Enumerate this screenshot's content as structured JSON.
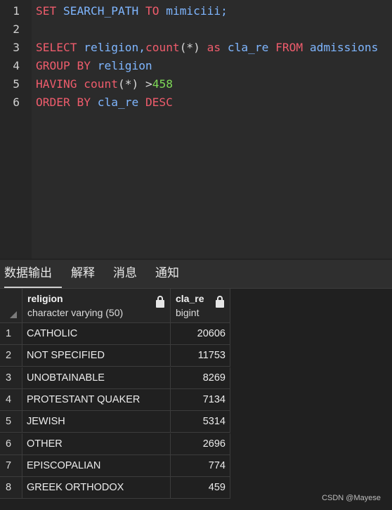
{
  "editor": {
    "lines": [
      {
        "num": "1",
        "tokens": [
          {
            "t": "SET",
            "c": "kw"
          },
          {
            "t": " ",
            "c": "op"
          },
          {
            "t": "SEARCH_PATH",
            "c": "id"
          },
          {
            "t": " ",
            "c": "op"
          },
          {
            "t": "TO",
            "c": "kw"
          },
          {
            "t": " mimiciii;",
            "c": "id"
          }
        ]
      },
      {
        "num": "2",
        "tokens": []
      },
      {
        "num": "3",
        "tokens": [
          {
            "t": "SELECT",
            "c": "kw"
          },
          {
            "t": " religion,",
            "c": "id"
          },
          {
            "t": "count",
            "c": "kw"
          },
          {
            "t": "(*)",
            "c": "op"
          },
          {
            "t": " as",
            "c": "kw"
          },
          {
            "t": " cla_re ",
            "c": "id"
          },
          {
            "t": "FROM",
            "c": "kw"
          },
          {
            "t": " admissions",
            "c": "id"
          }
        ]
      },
      {
        "num": "4",
        "tokens": [
          {
            "t": "GROUP BY",
            "c": "kw"
          },
          {
            "t": " religion",
            "c": "id"
          }
        ]
      },
      {
        "num": "5",
        "tokens": [
          {
            "t": "HAVING",
            "c": "kw"
          },
          {
            "t": " ",
            "c": "op"
          },
          {
            "t": "count",
            "c": "kw"
          },
          {
            "t": "(*) >",
            "c": "op"
          },
          {
            "t": "458",
            "c": "num"
          }
        ]
      },
      {
        "num": "6",
        "tokens": [
          {
            "t": "ORDER BY",
            "c": "kw"
          },
          {
            "t": " cla_re ",
            "c": "id"
          },
          {
            "t": "DESC",
            "c": "kw"
          }
        ]
      }
    ]
  },
  "tabs": [
    {
      "label": "数据输出",
      "active": true
    },
    {
      "label": "解释",
      "active": false
    },
    {
      "label": "消息",
      "active": false
    },
    {
      "label": "通知",
      "active": false
    }
  ],
  "grid": {
    "columns": [
      {
        "name": "religion",
        "type": "character varying (50)"
      },
      {
        "name": "cla_re",
        "type": "bigint"
      }
    ],
    "rows": [
      {
        "idx": "1",
        "religion": "CATHOLIC",
        "cla_re": "20606"
      },
      {
        "idx": "2",
        "religion": "NOT SPECIFIED",
        "cla_re": "11753"
      },
      {
        "idx": "3",
        "religion": "UNOBTAINABLE",
        "cla_re": "8269"
      },
      {
        "idx": "4",
        "religion": "PROTESTANT QUAKER",
        "cla_re": "7134"
      },
      {
        "idx": "5",
        "religion": "JEWISH",
        "cla_re": "5314"
      },
      {
        "idx": "6",
        "religion": "OTHER",
        "cla_re": "2696"
      },
      {
        "idx": "7",
        "religion": "EPISCOPALIAN",
        "cla_re": "774"
      },
      {
        "idx": "8",
        "religion": "GREEK ORTHODOX",
        "cla_re": "459"
      }
    ]
  },
  "watermark": "CSDN @Mayese",
  "colors": {
    "keyword": "#ef5c6c",
    "identifier": "#7fb6ff",
    "number": "#7ed957"
  }
}
